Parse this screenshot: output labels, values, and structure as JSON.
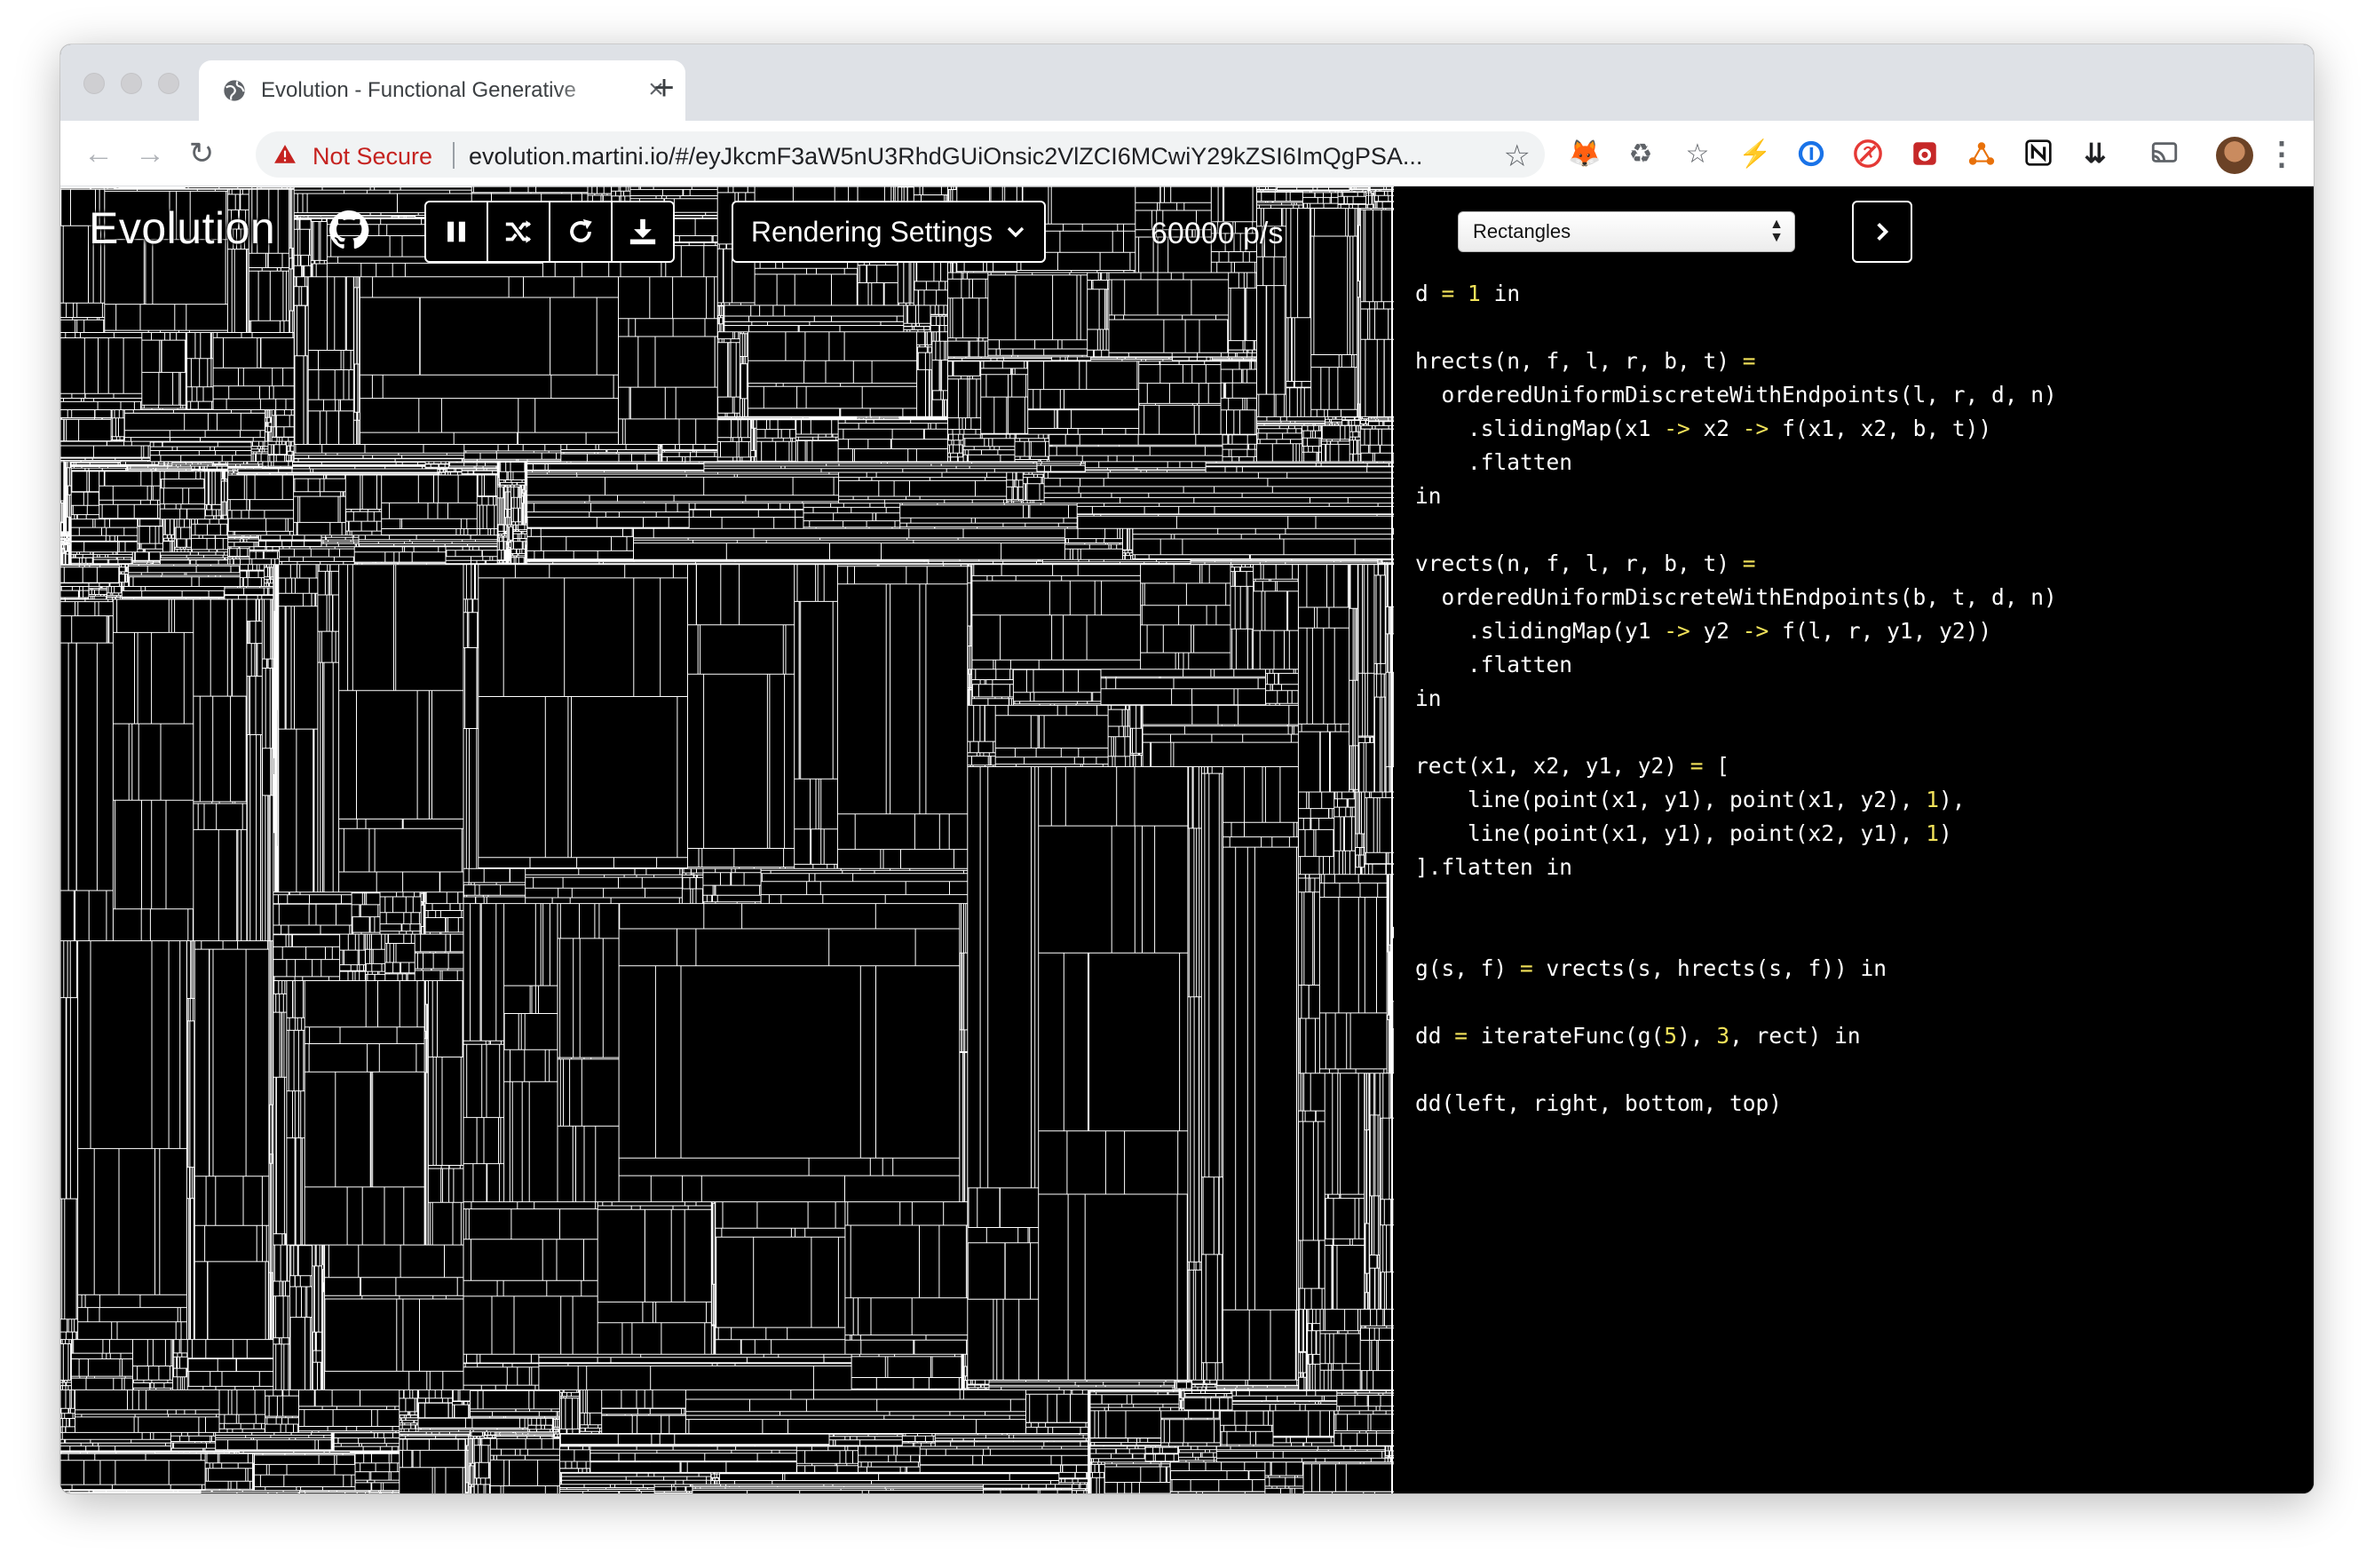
{
  "browser": {
    "tab_title": "Evolution - Functional Generative",
    "tab_close": "×",
    "new_tab": "+",
    "security_label": "Not Secure",
    "url": "evolution.martini.io/#/eyJkcmF3aW5nU3RhdGUiOnsic2VlZCI6MCwiY29kZSI6ImQgPSA..."
  },
  "app": {
    "title": "Evolution",
    "rendering_settings_label": "Rendering Settings",
    "rate": "60000 p/s",
    "preset_selected": "Rectangles"
  },
  "code": [
    [
      [
        "plain",
        "d "
      ],
      [
        "op",
        "="
      ],
      [
        "plain",
        " "
      ],
      [
        "num",
        "1"
      ],
      [
        "plain",
        " in"
      ]
    ],
    [],
    [
      [
        "plain",
        "hrects(n, f, l, r, b, t) "
      ],
      [
        "op",
        "="
      ]
    ],
    [
      [
        "plain",
        "  orderedUniformDiscreteWithEndpoints(l, r, d, n)"
      ]
    ],
    [
      [
        "plain",
        "    .slidingMap(x1 "
      ],
      [
        "op",
        "->"
      ],
      [
        "plain",
        " x2 "
      ],
      [
        "op",
        "->"
      ],
      [
        "plain",
        " f(x1, x2, b, t))"
      ]
    ],
    [
      [
        "plain",
        "    .flatten"
      ]
    ],
    [
      [
        "plain",
        "in"
      ]
    ],
    [],
    [
      [
        "plain",
        "vrects(n, f, l, r, b, t) "
      ],
      [
        "op",
        "="
      ]
    ],
    [
      [
        "plain",
        "  orderedUniformDiscreteWithEndpoints(b, t, d, n)"
      ]
    ],
    [
      [
        "plain",
        "    .slidingMap(y1 "
      ],
      [
        "op",
        "->"
      ],
      [
        "plain",
        " y2 "
      ],
      [
        "op",
        "->"
      ],
      [
        "plain",
        " f(l, r, y1, y2))"
      ]
    ],
    [
      [
        "plain",
        "    .flatten"
      ]
    ],
    [
      [
        "plain",
        "in"
      ]
    ],
    [],
    [
      [
        "plain",
        "rect(x1, x2, y1, y2) "
      ],
      [
        "op",
        "="
      ],
      [
        "plain",
        " ["
      ]
    ],
    [
      [
        "plain",
        "    line(point(x1, y1), point(x1, y2), "
      ],
      [
        "num",
        "1"
      ],
      [
        "plain",
        "),"
      ]
    ],
    [
      [
        "plain",
        "    line(point(x1, y1), point(x2, y1), "
      ],
      [
        "num",
        "1"
      ],
      [
        "plain",
        ")"
      ]
    ],
    [
      [
        "plain",
        "].flatten in"
      ]
    ],
    [],
    [],
    [
      [
        "plain",
        "g(s, f) "
      ],
      [
        "op",
        "="
      ],
      [
        "plain",
        " vrects(s, hrects(s, f)) in"
      ]
    ],
    [],
    [
      [
        "plain",
        "dd "
      ],
      [
        "op",
        "="
      ],
      [
        "plain",
        " iterateFunc(g("
      ],
      [
        "num",
        "5"
      ],
      [
        "plain",
        "), "
      ],
      [
        "num",
        "3"
      ],
      [
        "plain",
        ", rect) in"
      ]
    ],
    [],
    [
      [
        "plain",
        "dd(left, right, bottom, top)"
      ]
    ]
  ],
  "colors": {
    "background": "#000000",
    "line": "#ffffff",
    "code_keyword": "#f2e25a",
    "warning": "#c5221f"
  },
  "icons": {
    "favicon": "globe-icon",
    "warning": "warning-triangle-icon",
    "github": "github-icon",
    "pause": "pause-icon",
    "shuffle": "shuffle-icon",
    "reload": "reload-icon",
    "download": "download-icon",
    "next": "chevron-right-icon"
  }
}
